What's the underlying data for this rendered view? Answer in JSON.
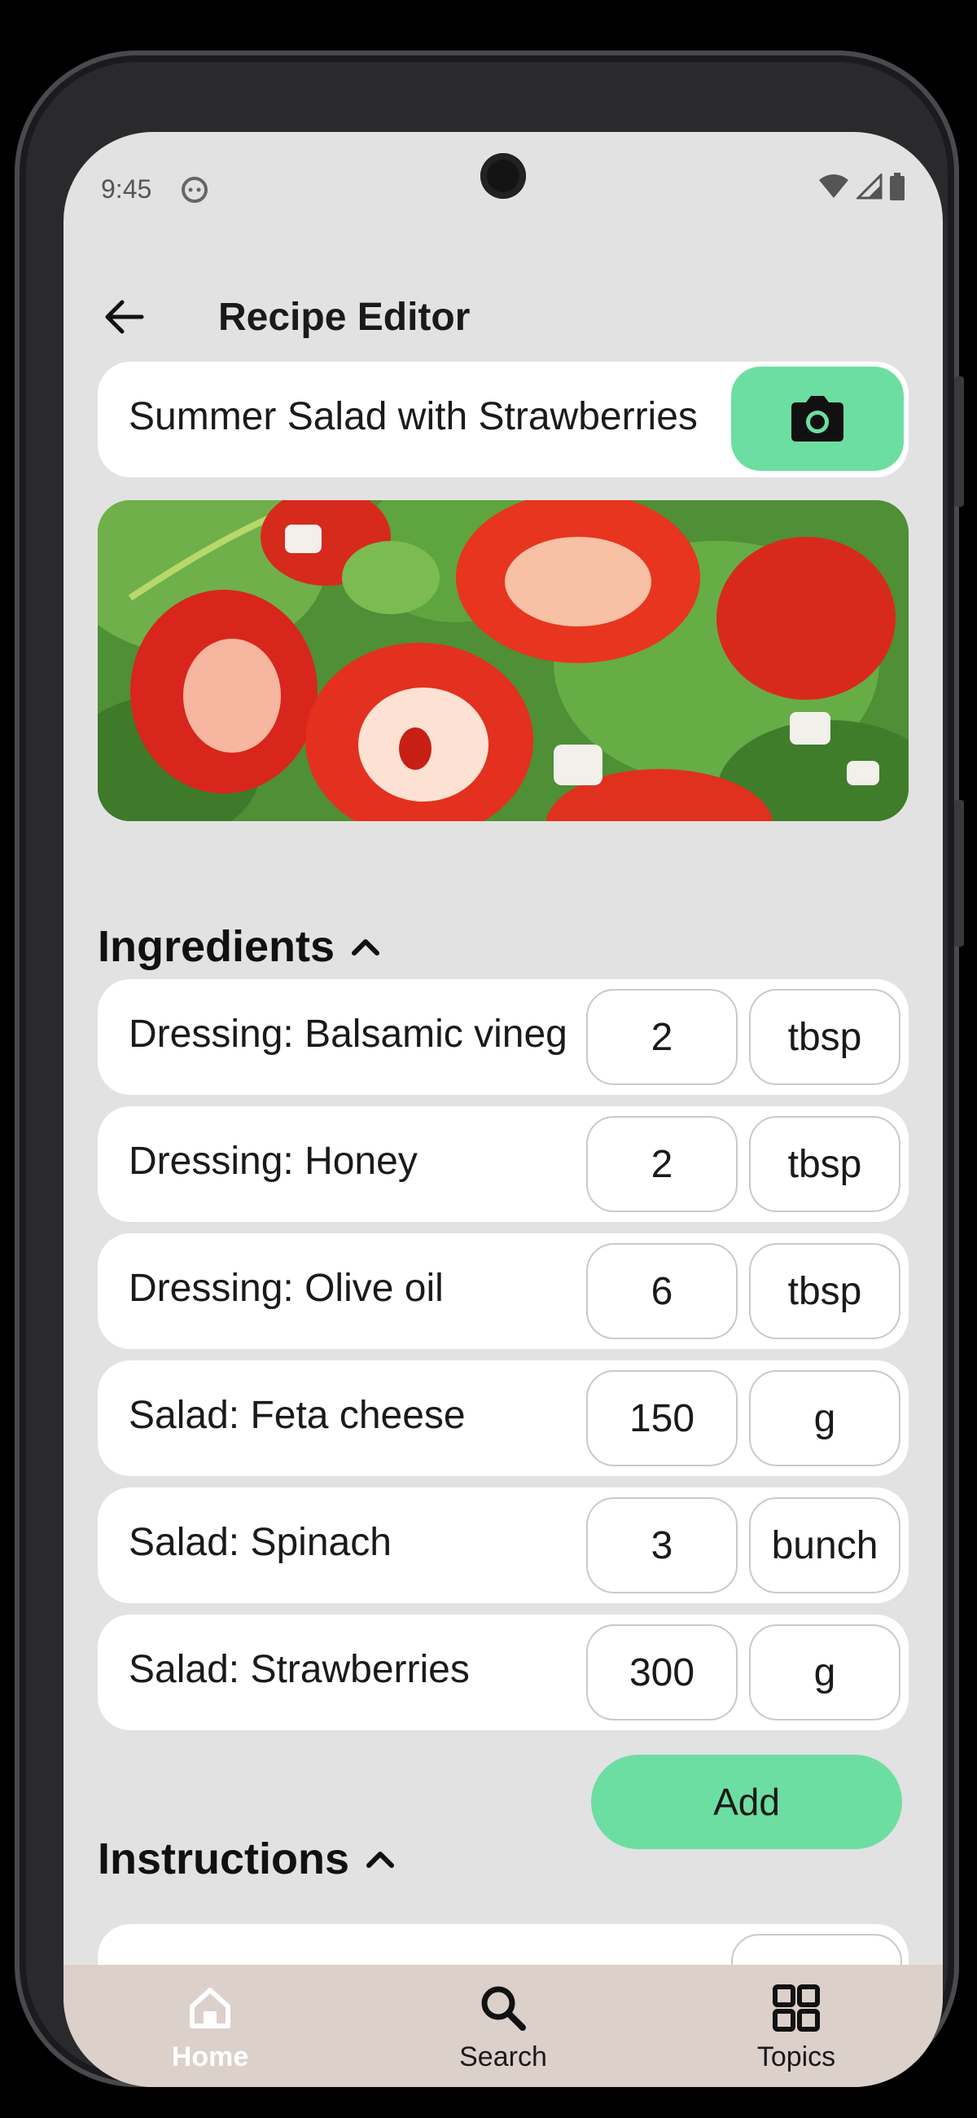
{
  "status_bar": {
    "time": "9:45"
  },
  "app_bar": {
    "title": "Recipe Editor",
    "back_icon": "arrow-left-icon"
  },
  "recipe": {
    "title_value": "Summer Salad with Strawberries",
    "camera_icon": "camera-icon",
    "photo_icon": "strawberry-salad-photo"
  },
  "ingredients": {
    "header": "Ingredients",
    "toggle_icon": "chevron-up-icon",
    "items": [
      {
        "name": "Dressing: Balsamic vinegar",
        "qty": "2",
        "unit": "tbsp"
      },
      {
        "name": "Dressing: Honey",
        "qty": "2",
        "unit": "tbsp"
      },
      {
        "name": "Dressing: Olive oil",
        "qty": "6",
        "unit": "tbsp"
      },
      {
        "name": "Salad: Feta cheese",
        "qty": "150",
        "unit": "g"
      },
      {
        "name": "Salad: Spinach",
        "qty": "3",
        "unit": "bunch"
      },
      {
        "name": "Salad: Strawberries",
        "qty": "300",
        "unit": "g"
      }
    ],
    "add_label": "Add"
  },
  "instructions": {
    "header": "Instructions",
    "toggle_icon": "chevron-up-icon"
  },
  "bottom_nav": {
    "items": [
      {
        "label": "Home",
        "icon": "home-icon",
        "active": true
      },
      {
        "label": "Search",
        "icon": "search-icon",
        "active": false
      },
      {
        "label": "Topics",
        "icon": "grid-icon",
        "active": false
      }
    ]
  },
  "colors": {
    "accent": "#6ddea2",
    "background": "#e2e2e2",
    "nav_background": "#dcd0cb"
  }
}
